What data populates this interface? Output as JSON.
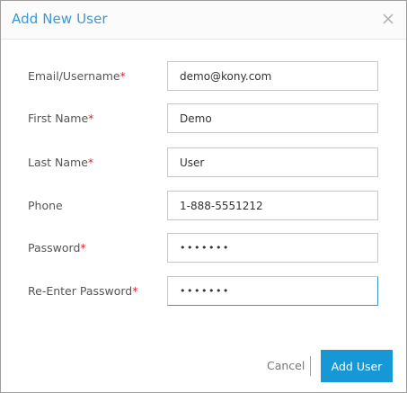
{
  "dialog": {
    "title": "Add New User",
    "close_icon": "close-icon"
  },
  "form": {
    "fields": [
      {
        "label": "Email/Username",
        "required": "*",
        "value": "demo@kony.com"
      },
      {
        "label": "First Name",
        "required": "*",
        "value": "Demo"
      },
      {
        "label": "Last Name",
        "required": "*",
        "value": "User"
      },
      {
        "label": "Phone",
        "required": "",
        "value": "1-888-5551212"
      },
      {
        "label": "Password",
        "required": "*",
        "value": "•••••••"
      },
      {
        "label": "Re-Enter Password",
        "required": "*",
        "value": "•••••••"
      }
    ]
  },
  "footer": {
    "cancel_label": "Cancel",
    "submit_label": "Add User"
  },
  "colors": {
    "accent": "#1798d6",
    "title": "#3d97d6",
    "required": "#d9262f"
  }
}
